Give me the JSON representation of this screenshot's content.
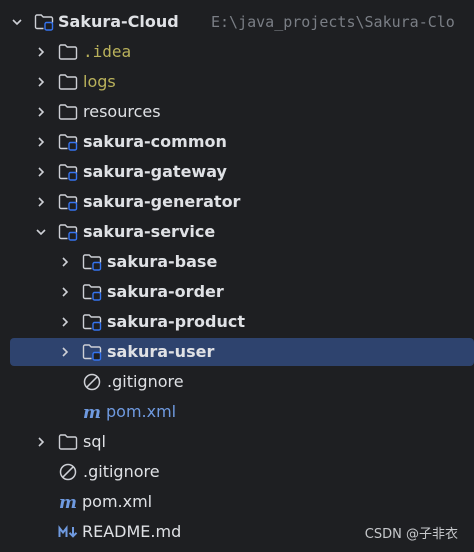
{
  "tree": {
    "root": {
      "label": "Sakura-Cloud",
      "path": "E:\\java_projects\\Sakura-Clo"
    },
    "items": [
      {
        "label": ".idea"
      },
      {
        "label": "logs"
      },
      {
        "label": "resources"
      },
      {
        "label": "sakura-common"
      },
      {
        "label": "sakura-gateway"
      },
      {
        "label": "sakura-generator"
      },
      {
        "label": "sakura-service"
      },
      {
        "label": "sakura-base"
      },
      {
        "label": "sakura-order"
      },
      {
        "label": "sakura-product"
      },
      {
        "label": "sakura-user"
      },
      {
        "label": ".gitignore"
      },
      {
        "label": "pom.xml"
      },
      {
        "label": "sql"
      },
      {
        "label": ".gitignore"
      },
      {
        "label": "pom.xml"
      },
      {
        "label": "README.md"
      }
    ]
  },
  "icons": {
    "folder": "folder-icon",
    "module": "module-folder-icon",
    "ignore": "ignore-file-icon",
    "maven": "maven-icon",
    "markdown": "markdown-icon"
  },
  "colors": {
    "background": "#1e1f22",
    "selection": "#2e436e",
    "text": "#dfe1e5",
    "ignored_text": "#b9b15b",
    "module_badge": "#3574f0",
    "maven_blue": "#6f9ae0"
  },
  "watermark": "CSDN @子非衣"
}
